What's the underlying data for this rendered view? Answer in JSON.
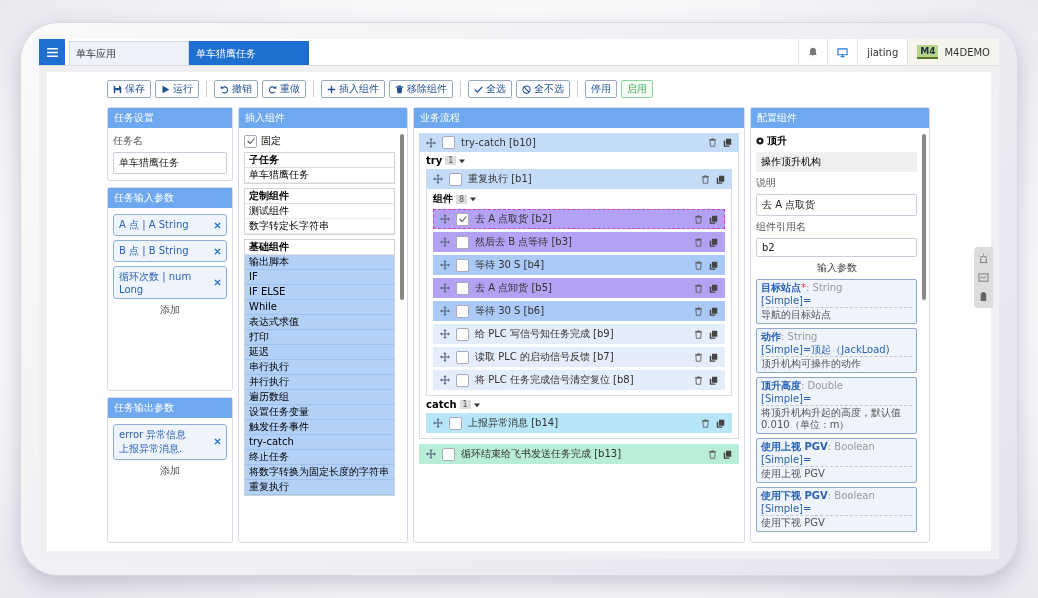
{
  "tabs": [
    {
      "label": "单车应用",
      "selected": false
    },
    {
      "label": "单车猎鹰任务",
      "selected": true
    }
  ],
  "header": {
    "user": "jiating",
    "logo": "M4",
    "org": "M4DEMO"
  },
  "toolbar_groups": [
    [
      {
        "label": "保存",
        "kind": "default"
      },
      {
        "label": "运行",
        "kind": "default"
      }
    ],
    [
      {
        "label": "撤销",
        "kind": "default"
      },
      {
        "label": "重做",
        "kind": "default"
      }
    ],
    [
      {
        "label": "插入组件",
        "kind": "default"
      },
      {
        "label": "移除组件",
        "kind": "default"
      }
    ],
    [
      {
        "label": "全选",
        "kind": "default"
      },
      {
        "label": "全不选",
        "kind": "default"
      }
    ],
    [
      {
        "label": "停用",
        "kind": "default"
      },
      {
        "label": "启用",
        "kind": "success"
      }
    ]
  ],
  "task_settings": {
    "title": "任务设置",
    "name_label": "任务名",
    "name_value": "单车猎鹰任务"
  },
  "input_params": {
    "title": "任务输入参数",
    "items": [
      "A 点 | A String",
      "B 点 | B String",
      "循环次数 | num Long"
    ],
    "add": "添加"
  },
  "output_params": {
    "title": "任务输出参数",
    "items": [
      {
        "lines": [
          "error 异常信息",
          "上报异常消息."
        ]
      }
    ],
    "add": "添加"
  },
  "insert": {
    "title": "插入组件",
    "pin": {
      "label": "固定",
      "checked": true
    },
    "groups": [
      {
        "title": "子任务",
        "kind": "plain",
        "items": [
          "单车猎鹰任务"
        ]
      },
      {
        "title": "定制组件",
        "kind": "plain",
        "items": [
          "测试组件",
          "数字转定长字符串"
        ]
      },
      {
        "title": "基础组件",
        "kind": "basic",
        "items": [
          "输出脚本",
          "IF",
          "IF ELSE",
          "While",
          "表达式求值",
          "打印",
          "延迟",
          "串行执行",
          "并行执行",
          "遍历数组",
          "设置任务变量",
          "触发任务事件",
          "try-catch",
          "终止任务",
          "将数字转换为固定长度的字符串",
          "重复执行"
        ]
      }
    ]
  },
  "flow": {
    "title": "业务流程",
    "blocks": [
      {
        "label": "try-catch [b10]",
        "color": "#c5dcf8",
        "checked": false,
        "selected": false,
        "sections": [
          {
            "label": "try",
            "count": "1",
            "children": [
              {
                "label": "重复执行 [b1]",
                "color": "#c5dcf8",
                "checked": false,
                "selected": false,
                "sections": [
                  {
                    "label": "组件",
                    "count": "8",
                    "children": [
                      {
                        "label": "去 A 点取货 [b2]",
                        "color": "#b3a1f3",
                        "checked": true,
                        "selected": true
                      },
                      {
                        "label": "然后去 B 点等待 [b3]",
                        "color": "#b3a1f3",
                        "checked": false,
                        "selected": false
                      },
                      {
                        "label": "等待 30 S [b4]",
                        "color": "#abc9f6",
                        "checked": false,
                        "selected": false
                      },
                      {
                        "label": "去 A 点卸货 [b5]",
                        "color": "#b3a1f3",
                        "checked": false,
                        "selected": false
                      },
                      {
                        "label": "等待 30 S [b6]",
                        "color": "#abc9f6",
                        "checked": false,
                        "selected": false
                      },
                      {
                        "label": "给 PLC 写信号知任务完成 [b9]",
                        "color": "#e4edfb",
                        "checked": false,
                        "selected": false
                      },
                      {
                        "label": "读取 PLC 的启动信号反馈 [b7]",
                        "color": "#e4edfb",
                        "checked": false,
                        "selected": false
                      },
                      {
                        "label": "将 PLC 任务完成信号清空复位 [b8]",
                        "color": "#e4edfb",
                        "checked": false,
                        "selected": false
                      }
                    ]
                  }
                ]
              }
            ]
          },
          {
            "label": "catch",
            "count": "1",
            "children": [
              {
                "label": "上报异常消息 [b14]",
                "color": "#b6e6f8",
                "checked": false,
                "selected": false
              }
            ]
          }
        ]
      },
      {
        "label": "循环结束给飞书发送任务完成 [b13]",
        "color": "#b8edd8",
        "checked": false,
        "selected": false
      }
    ]
  },
  "config": {
    "title": "配置组件",
    "component": "顶升",
    "description": "操作顶升机构",
    "desc_label": "说明",
    "desc_value": "去 A 点取货",
    "ref_label": "组件引用名",
    "ref_value": "b2",
    "params_title": "输入参数",
    "params": [
      {
        "name": "目标站点",
        "marker": "*",
        "type": ": String",
        "value": "[Simple]=",
        "note": "导航的目标站点"
      },
      {
        "name": "动作",
        "type": ": String",
        "value": "[Simple]=顶起（JackLoad)",
        "note": "顶升机构可操作的动作"
      },
      {
        "name": "顶升高度",
        "type": ": Double",
        "value": "[Simple]=",
        "note": "将顶升机构升起的高度，默认值 0.010（单位：m）"
      },
      {
        "name": "使用上视 PGV",
        "type": ": Boolean",
        "value": "[Simple]=",
        "note": "使用上视 PGV"
      },
      {
        "name": "使用下视 PGV",
        "type": ": Boolean",
        "value": "[Simple]=",
        "note": "使用下视 PGV"
      }
    ]
  }
}
